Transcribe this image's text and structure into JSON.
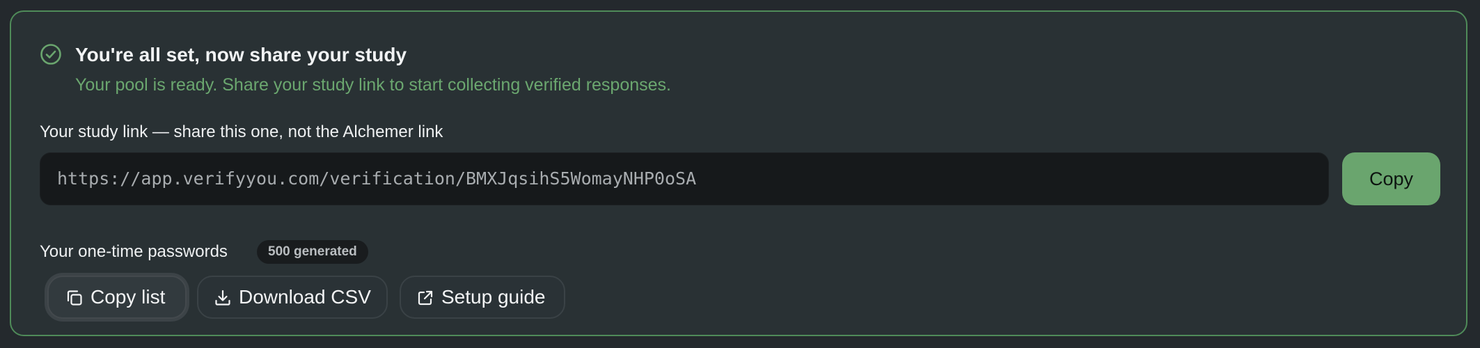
{
  "header": {
    "title": "You're all set, now share your study",
    "subtitle": "Your pool is ready. Share your study link to start collecting verified responses."
  },
  "study_link": {
    "label": "Your study link — share this one, not the Alchemer link",
    "url": "https://app.verifyyou.com/verification/BMXJqsihS5WomayNHP0oSA",
    "copy_label": "Copy"
  },
  "passwords": {
    "label": "Your one-time passwords",
    "badge": "500 generated",
    "buttons": {
      "copy_list": "Copy list",
      "download_csv": "Download CSV",
      "setup_guide": "Setup guide"
    }
  },
  "colors": {
    "accent": "#6aa56e",
    "border": "#4f8b59",
    "background": "#24292d",
    "card": "#293134"
  },
  "icons": {
    "status": "check-circle-icon",
    "copy_list": "copy-icon",
    "download_csv": "download-icon",
    "setup_guide": "external-link-icon"
  }
}
